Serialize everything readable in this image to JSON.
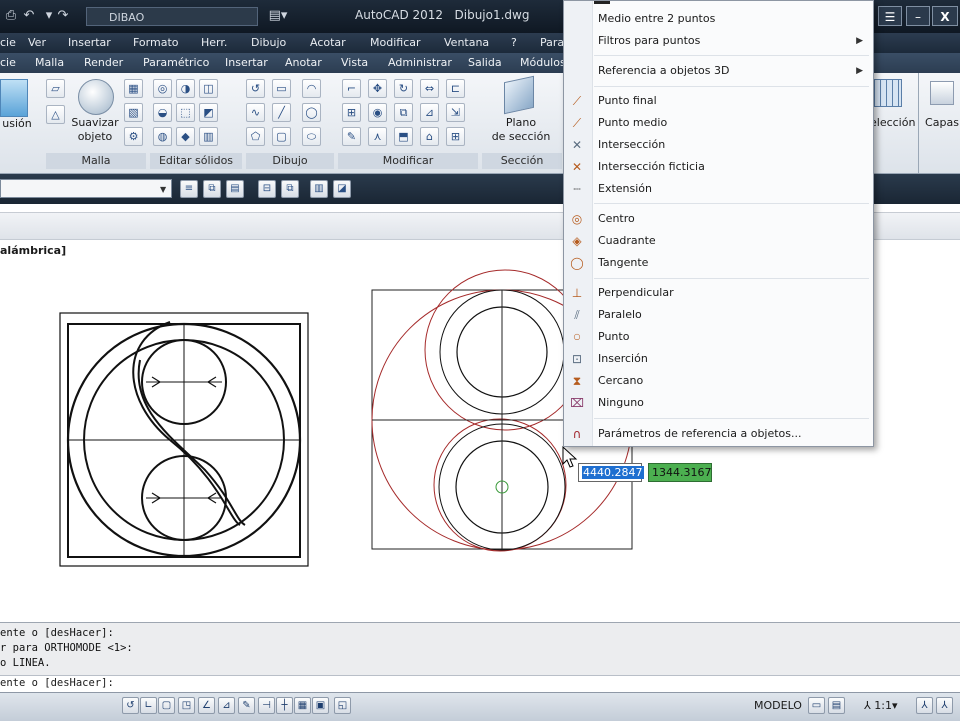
{
  "window": {
    "app_title": "AutoCAD 2012",
    "file_name": "Dibujo1.dwg",
    "workspace": "DIBAO",
    "close_label": "X"
  },
  "menubar": [
    "cie",
    "Ver",
    "Insertar",
    "Formato",
    "Herr.",
    "Dibujo",
    "Acotar",
    "Modificar",
    "Ventana",
    "?",
    "Para"
  ],
  "ribbon_tabs": [
    "cie",
    "Malla",
    "Render",
    "Paramétrico",
    "Insertar",
    "Anotar",
    "Vista",
    "Administrar",
    "Salida",
    "Módulos"
  ],
  "ribbon": {
    "big_left_label": "usión",
    "suavizar_label_1": "Suavizar",
    "suavizar_label_2": "objeto",
    "plano_label_1": "Plano",
    "plano_label_2": "de sección",
    "seleccion_label": "elección",
    "capas_label": "Capas",
    "panels": [
      "Malla",
      "Editar sólidos",
      "Dibujo",
      "Modificar",
      "Sección"
    ]
  },
  "viewport": {
    "label": "alámbrica]"
  },
  "osnap_menu": {
    "items": [
      {
        "label": "Medio entre 2 puntos",
        "icon": "",
        "submenu": false
      },
      {
        "label": "Filtros para puntos",
        "icon": "",
        "submenu": true
      },
      {
        "label": "Referencia a objetos 3D",
        "icon": "",
        "submenu": true
      },
      {
        "label": "Punto final",
        "icon": "endpoint-icon",
        "submenu": false
      },
      {
        "label": "Punto medio",
        "icon": "midpoint-icon",
        "submenu": false
      },
      {
        "label": "Intersección",
        "icon": "intersection-icon",
        "submenu": false
      },
      {
        "label": "Intersección ficticia",
        "icon": "apparent-intersection-icon",
        "submenu": false
      },
      {
        "label": "Extensión",
        "icon": "extension-icon",
        "submenu": false
      },
      {
        "label": "Centro",
        "icon": "center-icon",
        "submenu": false
      },
      {
        "label": "Cuadrante",
        "icon": "quadrant-icon",
        "submenu": false
      },
      {
        "label": "Tangente",
        "icon": "tangent-icon",
        "submenu": false
      },
      {
        "label": "Perpendicular",
        "icon": "perpendicular-icon",
        "submenu": false
      },
      {
        "label": "Paralelo",
        "icon": "parallel-icon",
        "submenu": false
      },
      {
        "label": "Punto",
        "icon": "node-icon",
        "submenu": false
      },
      {
        "label": "Inserción",
        "icon": "insertion-icon",
        "submenu": false
      },
      {
        "label": "Cercano",
        "icon": "nearest-icon",
        "submenu": false
      },
      {
        "label": "Ninguno",
        "icon": "none-icon",
        "submenu": false
      },
      {
        "label": "Parámetros de referencia a objetos...",
        "icon": "osnap-settings-icon",
        "submenu": false
      }
    ]
  },
  "coordinates": {
    "x_value": "4440.2847",
    "y_value": "1344.3167"
  },
  "command_line": {
    "lines": [
      "ente o [desHacer]:",
      "r para ORTHOMODE <1>:",
      "o LINEA."
    ],
    "prompt": "ente o [desHacer]:"
  },
  "statusbar": {
    "model_label": "MODELO",
    "scale_label": "1:1"
  },
  "colors": {
    "dark_chrome": "#1c2a3a",
    "drawing_red": "#a52a2a",
    "coord_x_bg": "#1f6fd0",
    "coord_y_bg": "#4caf50"
  }
}
